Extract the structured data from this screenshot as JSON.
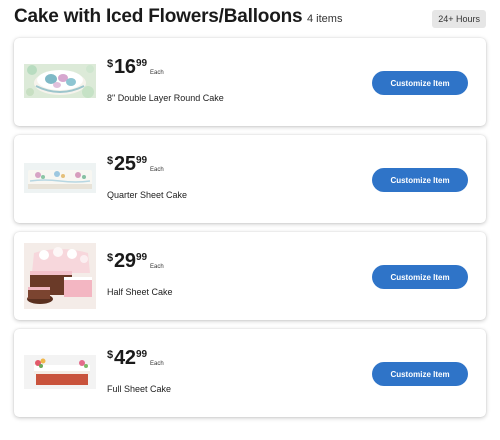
{
  "header": {
    "title": "Cake with Iced Flowers/Balloons",
    "count": "4 items",
    "badge": "24+ Hours"
  },
  "products": [
    {
      "currency": "$",
      "dollars": "16",
      "cents": "99",
      "unit": "Each",
      "name": "8\" Double Layer Round Cake",
      "button": "Customize Item",
      "image": "round-cake-image"
    },
    {
      "currency": "$",
      "dollars": "25",
      "cents": "99",
      "unit": "Each",
      "name": "Quarter Sheet Cake",
      "button": "Customize Item",
      "image": "quarter-sheet-cake-image"
    },
    {
      "currency": "$",
      "dollars": "29",
      "cents": "99",
      "unit": "Each",
      "name": "Half Sheet Cake",
      "button": "Customize Item",
      "image": "half-sheet-cake-image"
    },
    {
      "currency": "$",
      "dollars": "42",
      "cents": "99",
      "unit": "Each",
      "name": "Full Sheet Cake",
      "button": "Customize Item",
      "image": "full-sheet-cake-image"
    }
  ],
  "colors": {
    "button": "#2f74c8",
    "badge_bg": "#e6e6e6"
  }
}
